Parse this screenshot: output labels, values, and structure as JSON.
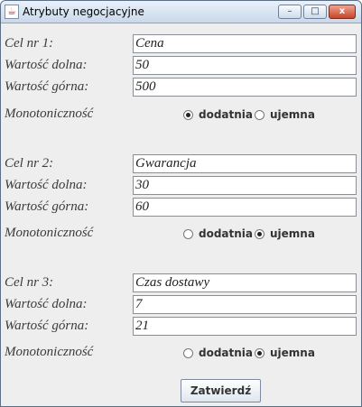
{
  "window": {
    "title": "Atrybuty negocjacyjne",
    "buttons": {
      "minimize": "–",
      "maximize": "□",
      "close": "x"
    }
  },
  "sections": [
    {
      "goal_label": "Cel nr 1:",
      "goal_value": "Cena",
      "lower_label": "Wartość dolna:",
      "lower_value": "50",
      "upper_label": "Wartość górna:",
      "upper_value": "500",
      "monotonic_label": "Monotoniczność",
      "positive_label": "dodatnia",
      "negative_label": "ujemna",
      "selected": "dodatnia"
    },
    {
      "goal_label": "Cel nr 2:",
      "goal_value": "Gwarancja",
      "lower_label": "Wartość dolna:",
      "lower_value": "30",
      "upper_label": "Wartość górna:",
      "upper_value": "60",
      "monotonic_label": "Monotoniczność",
      "positive_label": "dodatnia",
      "negative_label": "ujemna",
      "selected": "ujemna"
    },
    {
      "goal_label": "Cel nr 3:",
      "goal_value": "Czas dostawy",
      "lower_label": "Wartość dolna:",
      "lower_value": "7",
      "upper_label": "Wartość górna:",
      "upper_value": "21",
      "monotonic_label": "Monotoniczność",
      "positive_label": "dodatnia",
      "negative_label": "ujemna",
      "selected": "ujemna"
    }
  ],
  "confirm_label": "Zatwierdź"
}
